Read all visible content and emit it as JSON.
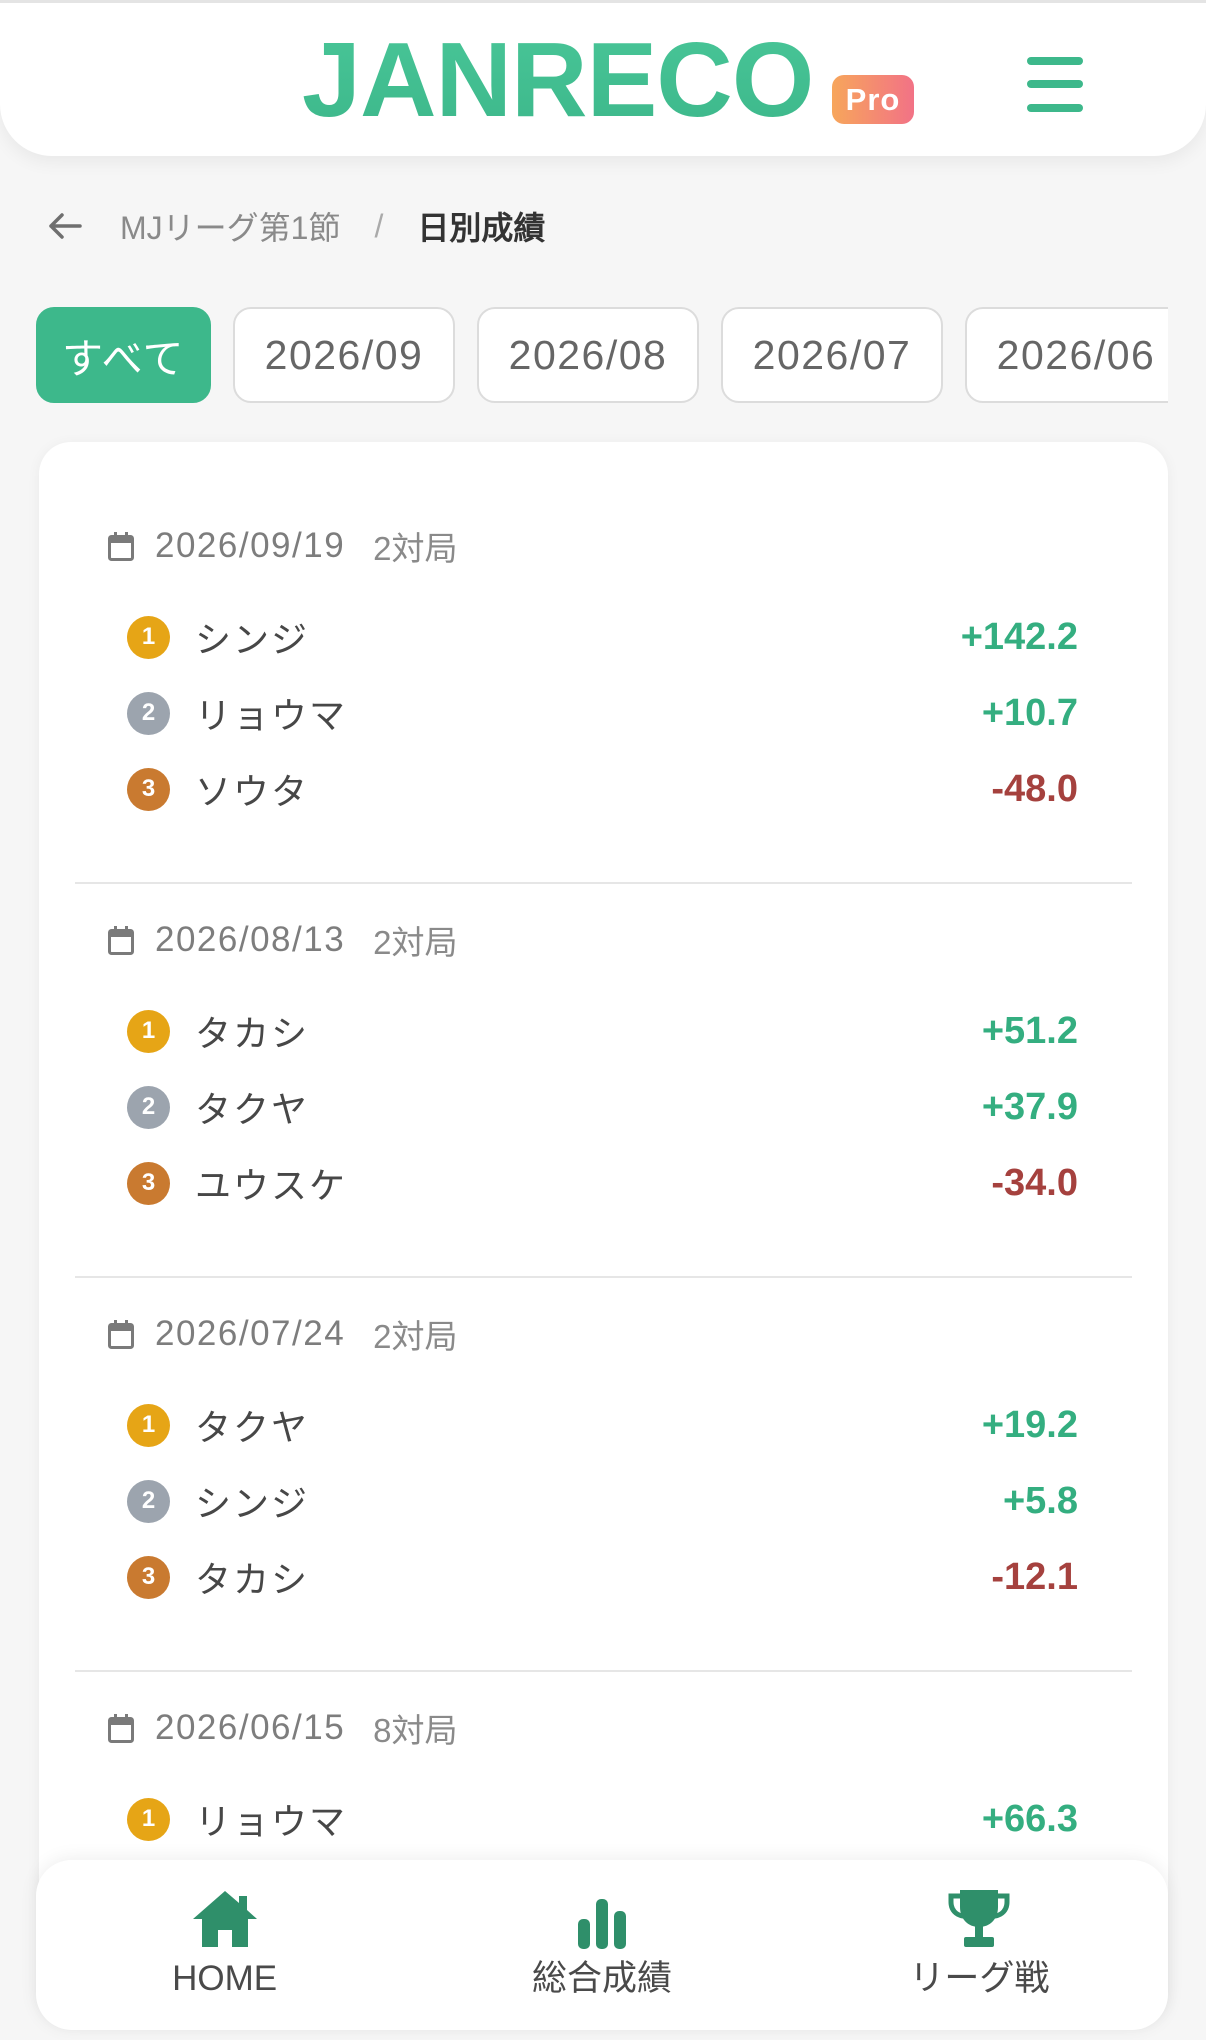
{
  "app": {
    "logo": "JANRECO",
    "badge": "Pro",
    "menu_icon": "hamburger-menu-icon"
  },
  "theme": {
    "brand_green": "#3DB88B",
    "positive": "#34AE80",
    "negative": "#A5413E",
    "rank_1": "#E6A516",
    "rank_2": "#9CA4AE",
    "rank_3": "#C97A30",
    "nav_icon": "#2F8F6A"
  },
  "breadcrumb": {
    "back_icon": "back-arrow-icon",
    "parent": "MJリーグ第1節",
    "separator": "/",
    "current": "日別成績"
  },
  "filters": {
    "selected_index": 0,
    "items": [
      "すべて",
      "2026/09",
      "2026/08",
      "2026/07",
      "2026/06"
    ]
  },
  "day_icon": "calendar-icon",
  "days": [
    {
      "date": "2026/09/19",
      "games": "2対局",
      "players": [
        {
          "rank": 1,
          "name": "シンジ",
          "score": "+142.2"
        },
        {
          "rank": 2,
          "name": "リョウマ",
          "score": "+10.7"
        },
        {
          "rank": 3,
          "name": "ソウタ",
          "score": "-48.0"
        }
      ]
    },
    {
      "date": "2026/08/13",
      "games": "2対局",
      "players": [
        {
          "rank": 1,
          "name": "タカシ",
          "score": "+51.2"
        },
        {
          "rank": 2,
          "name": "タクヤ",
          "score": "+37.9"
        },
        {
          "rank": 3,
          "name": "ユウスケ",
          "score": "-34.0"
        }
      ]
    },
    {
      "date": "2026/07/24",
      "games": "2対局",
      "players": [
        {
          "rank": 1,
          "name": "タクヤ",
          "score": "+19.2"
        },
        {
          "rank": 2,
          "name": "シンジ",
          "score": "+5.8"
        },
        {
          "rank": 3,
          "name": "タカシ",
          "score": "-12.1"
        }
      ]
    },
    {
      "date": "2026/06/15",
      "games": "8対局",
      "players": [
        {
          "rank": 1,
          "name": "リョウマ",
          "score": "+66.3"
        }
      ]
    }
  ],
  "nav": {
    "items": [
      {
        "label": "HOME",
        "icon": "home-icon"
      },
      {
        "label": "総合成績",
        "icon": "bar-chart-icon"
      },
      {
        "label": "リーグ戦",
        "icon": "trophy-icon"
      }
    ]
  }
}
